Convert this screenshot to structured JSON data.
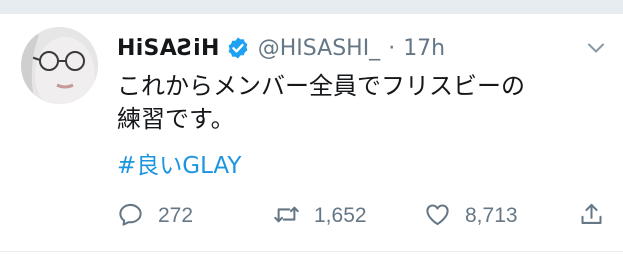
{
  "tweet": {
    "author": {
      "display_name": "HiSAƧiH",
      "handle": "@HISASHI_",
      "verified": true
    },
    "separator": "·",
    "timestamp": "17h",
    "text_line1": "これからメンバー全員でフリスビーの",
    "text_line2": "練習です。",
    "hashtag": "#良いGLAY",
    "stats": {
      "replies": "272",
      "retweets": "1,652",
      "likes": "8,713"
    }
  },
  "icons": {
    "verified": "verified-badge-icon",
    "caret": "chevron-down-icon",
    "reply": "reply-icon",
    "retweet": "retweet-icon",
    "like": "heart-icon",
    "share": "share-icon"
  },
  "colors": {
    "link": "#1b95e0",
    "text": "#14171a",
    "secondary": "#657786",
    "verified": "#1da1f2",
    "divider": "#e6ecf0"
  }
}
